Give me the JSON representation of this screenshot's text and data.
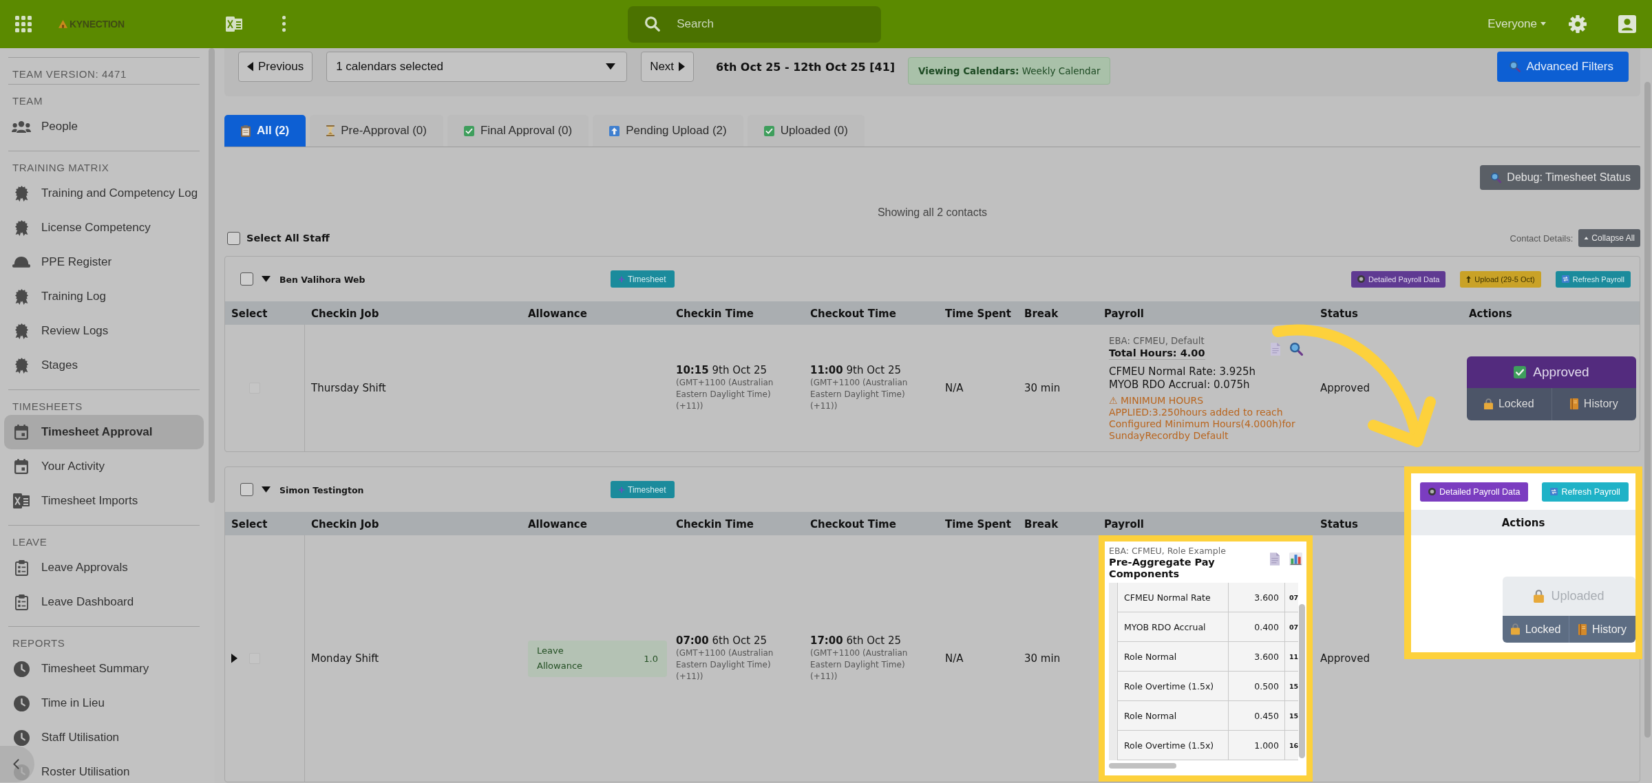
{
  "top_bar": {
    "logo": "KYNECTION",
    "search": {
      "placeholder": "Search"
    },
    "user_filter": "Everyone"
  },
  "sidebar": {
    "version": "TEAM VERSION: 4471",
    "sections": [
      {
        "heading": "TEAM",
        "items": [
          {
            "label": "People",
            "kind": "people",
            "selected": false
          }
        ]
      },
      {
        "heading": "TRAINING MATRIX",
        "items": [
          {
            "label": "Training and Competency Log",
            "kind": "badge",
            "selected": false
          },
          {
            "label": "License Competency",
            "kind": "badge",
            "selected": false
          },
          {
            "label": "PPE Register",
            "kind": "helmet",
            "selected": false
          },
          {
            "label": "Training Log",
            "kind": "badge",
            "selected": false
          },
          {
            "label": "Review Logs",
            "kind": "badge",
            "selected": false
          },
          {
            "label": "Stages",
            "kind": "badge",
            "selected": false
          }
        ]
      },
      {
        "heading": "TIMESHEETS",
        "items": [
          {
            "label": "Timesheet Approval",
            "kind": "calendar",
            "selected": true
          },
          {
            "label": "Your Activity",
            "kind": "calendar",
            "selected": false
          },
          {
            "label": "Timesheet Imports",
            "kind": "spreadsheet",
            "selected": false
          }
        ]
      },
      {
        "heading": "LEAVE",
        "items": [
          {
            "label": "Leave Approvals",
            "kind": "clipboard",
            "selected": false
          },
          {
            "label": "Leave Dashboard",
            "kind": "clipboard",
            "selected": false
          }
        ]
      },
      {
        "heading": "REPORTS",
        "items": [
          {
            "label": "Timesheet Summary",
            "kind": "clock",
            "selected": false
          },
          {
            "label": "Time in Lieu",
            "kind": "clock",
            "selected": false
          },
          {
            "label": "Staff Utilisation",
            "kind": "clock",
            "selected": false
          },
          {
            "label": "Roster Utilisation",
            "kind": "clock",
            "selected": false
          }
        ]
      }
    ]
  },
  "filter_bar": {
    "previous": "Previous",
    "calendar_select": "1 calendars selected",
    "next": "Next",
    "date_range": "6th Oct 25 - 12th Oct 25 [41]",
    "viewing": "**Viewing Calendars:** Weekly Calendar",
    "advanced_filters": "Advanced Filters"
  },
  "tabs": [
    {
      "label": "All (2)",
      "kind": "clipboard",
      "selected": true
    },
    {
      "label": "Pre-Approval (0)",
      "kind": "hourglass",
      "selected": false
    },
    {
      "label": "Final Approval (0)",
      "kind": "check",
      "selected": false
    },
    {
      "label": "Pending Upload (2)",
      "kind": "upload",
      "selected": false
    },
    {
      "label": "Uploaded (0)",
      "kind": "check",
      "selected": false
    }
  ],
  "debug_button": "Debug: Timesheet Status",
  "summary": "Showing all 2 contacts",
  "select_all": {
    "label": "Select All Staff",
    "checked": false
  },
  "contact_details": {
    "label": "Contact Details:",
    "collapse_button": "Collapse All"
  },
  "contacts": [
    {
      "name": "Ben Valihora Web",
      "checked": false,
      "expanded": true,
      "timesheet_button": "Timesheet",
      "spotlight": false,
      "buttons": [
        {
          "label": "Detailed Payroll Data",
          "kind": "payroll"
        },
        {
          "label": "Upload (29-5 Oct)",
          "kind": "upload"
        },
        {
          "label": "Refresh Payroll",
          "kind": "refresh"
        }
      ],
      "columns": [
        "Select",
        "Checkin Job",
        "Allowance",
        "Checkin Time",
        "Checkout Time",
        "Time Spent",
        "Break",
        "Payroll",
        "Status",
        "Actions"
      ],
      "rows": [
        {
          "expandable": false,
          "checked": false,
          "checkbox_disabled": true,
          "job": "Thursday Shift",
          "checkin": {
            "time": "**10:15** 9th Oct 25",
            "zone": "(GMT+1100 (Australian Eastern Daylight Time) (+11))"
          },
          "checkout": {
            "time": "**11:00** 9th Oct 25",
            "zone": "(GMT+1100 (Australian Eastern Daylight Time) (+11))"
          },
          "time_spent": "N/A",
          "break": "30 min",
          "payroll": {
            "kind": "summary",
            "highlighted": false,
            "eba": "EBA: CFMEU, Default",
            "total": "Total Hours: 4.00",
            "lines": [
              "CFMEU Normal Rate: 3.925h",
              "MYOB RDO Accrual: 0.075h"
            ],
            "warning": "⚠ MINIMUM HOURS APPLIED:3.250hours added to reach Configured Minimum Hours(4.000h)for SundayRecordby Default"
          },
          "status": "Approved",
          "action": {
            "kind": "approved",
            "label": "Approved",
            "buttons": [
              {
                "label": "Locked",
                "kind": "lock"
              },
              {
                "label": "History",
                "kind": "history"
              }
            ]
          }
        }
      ]
    },
    {
      "name": "Simon Testington",
      "checked": false,
      "expanded": true,
      "timesheet_button": "Timesheet",
      "spotlight": true,
      "buttons": [
        {
          "label": "Detailed Payroll Data",
          "kind": "payroll"
        },
        {
          "label": "Refresh Payroll",
          "kind": "refresh"
        }
      ],
      "columns": [
        "Select",
        "Checkin Job",
        "Allowance",
        "Checkin Time",
        "Checkout Time",
        "Time Spent",
        "Break",
        "Payroll",
        "Status",
        "Actions"
      ],
      "rows": [
        {
          "expandable": true,
          "checked": false,
          "checkbox_disabled": true,
          "job": "Monday Shift",
          "allowance": {
            "label": "Leave Allowance",
            "value": "1.0"
          },
          "checkin": {
            "time": "**07:00** 6th Oct 25",
            "zone": "(GMT+1100 (Australian Eastern Daylight Time) (+11))"
          },
          "checkout": {
            "time": "**17:00** 6th Oct 25",
            "zone": "(GMT+1100 (Australian Eastern Daylight Time) (+11))"
          },
          "time_spent": "N/A",
          "break": "30 min",
          "payroll": {
            "kind": "components",
            "highlighted": true,
            "eba": "EBA: CFMEU, Role Example",
            "title": "Pre-Aggregate Pay Components",
            "components": [
              {
                "name": "CFMEU Normal Rate",
                "hours": "3.600",
                "column_3": "07"
              },
              {
                "name": "MYOB RDO Accrual",
                "hours": "0.400",
                "column_3": "07"
              },
              {
                "name": "Role Normal",
                "hours": "3.600",
                "column_3": "11"
              },
              {
                "name": "Role Overtime (1.5x)",
                "hours": "0.500",
                "column_3": "15"
              },
              {
                "name": "Role Normal",
                "hours": "0.450",
                "column_3": "15"
              },
              {
                "name": "Role Overtime (1.5x)",
                "hours": "1.000",
                "column_3": "16"
              }
            ]
          },
          "status": "Approved",
          "action": {
            "kind": "uploaded",
            "label": "Uploaded",
            "buttons": [
              {
                "label": "Locked",
                "kind": "lock"
              },
              {
                "label": "History",
                "kind": "history"
              }
            ]
          }
        }
      ]
    }
  ],
  "callout_arrow": true
}
